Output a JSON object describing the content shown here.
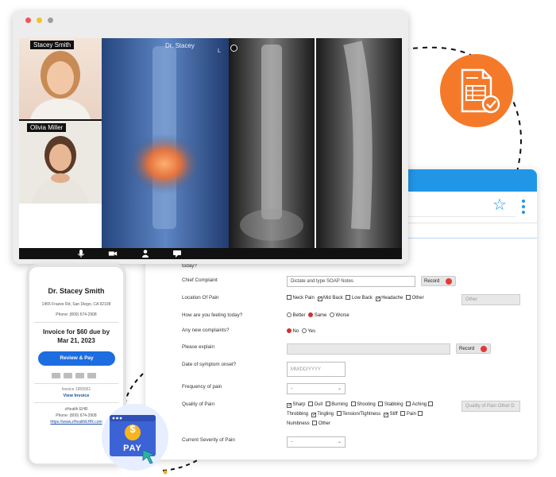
{
  "video": {
    "participants": [
      {
        "name": "Stacey Smith"
      },
      {
        "name": "Olivia Miller"
      }
    ],
    "main_label": "Dr. Stacey",
    "xray_marker": "L",
    "toolbar": [
      "microphone-icon",
      "camera-icon",
      "person-icon",
      "chat-icon"
    ]
  },
  "form": {
    "rows": [
      {
        "label": "today?"
      },
      {
        "label": "Chief Complaint",
        "value": "Dictate and type SOAP Notes",
        "button": "Record"
      },
      {
        "label": "Location Of Pain",
        "options": [
          {
            "text": "Neck Pain",
            "checked": false
          },
          {
            "text": "Mid Back",
            "checked": true
          },
          {
            "text": "Low Back",
            "checked": false
          },
          {
            "text": "Headache",
            "checked": true
          },
          {
            "text": "Other",
            "checked": false
          }
        ],
        "other_placeholder": "Other"
      },
      {
        "label": "How are you feeling today?",
        "options": [
          {
            "text": "Better",
            "checked": false
          },
          {
            "text": "Same",
            "checked": true
          },
          {
            "text": "Worse",
            "checked": false
          }
        ]
      },
      {
        "label": "Any new complaints?",
        "options": [
          {
            "text": "No",
            "checked": true
          },
          {
            "text": "Yes",
            "checked": false
          }
        ]
      },
      {
        "label": "Please explain",
        "button": "Record"
      },
      {
        "label": "Date of symptom onset?",
        "placeholder": "MM/DD/YYYY"
      },
      {
        "label": "Frequency of pain",
        "select": "-"
      },
      {
        "label": "Quality of Pain",
        "options_line1": [
          {
            "text": "Sharp",
            "checked": true
          },
          {
            "text": "Dull",
            "checked": false
          },
          {
            "text": "Burning",
            "checked": false
          },
          {
            "text": "Shooting",
            "checked": false
          },
          {
            "text": "Stabbing",
            "checked": false
          },
          {
            "text": "Aching",
            "checked": false
          }
        ],
        "options_line2": [
          {
            "text": "Throbbing",
            "checked": false
          },
          {
            "text": "Tingling",
            "checked": true
          },
          {
            "text": "Tension/Tightness",
            "checked": false
          },
          {
            "text": "Stiff",
            "checked": true
          },
          {
            "text": "Pain",
            "checked": false
          }
        ],
        "options_line3": [
          {
            "text": "Numbness",
            "checked": false
          },
          {
            "text": "Other",
            "checked": false
          }
        ],
        "other_placeholder": "Quality of Pain Other D"
      },
      {
        "label": "Current Severity of Pain",
        "select": "-"
      }
    ]
  },
  "phone": {
    "doctor": "Dr. Stacey Smith",
    "address": "1455 Frazee Rd, San Diego, CA 92108",
    "phone": "Phone: (800) 674-2908",
    "invoice_line1": "Invoice for $60 due by",
    "invoice_line2": "Mar 21, 2023",
    "pay_button": "Review & Pay",
    "invoice_number": "Invoice 1955561",
    "view_invoice": "View Invoice",
    "brand": "zHealth EHR",
    "brand_phone": "Phone: (800) 674-2908",
    "brand_url": "https://www.zHealthEHR.com"
  },
  "pay_badge": {
    "coin": "$",
    "label": "PAY"
  },
  "colors": {
    "accent_blue": "#2196e6",
    "pay_blue": "#1c6de0",
    "record_red": "#e53935",
    "badge_orange": "#f47a2a"
  }
}
